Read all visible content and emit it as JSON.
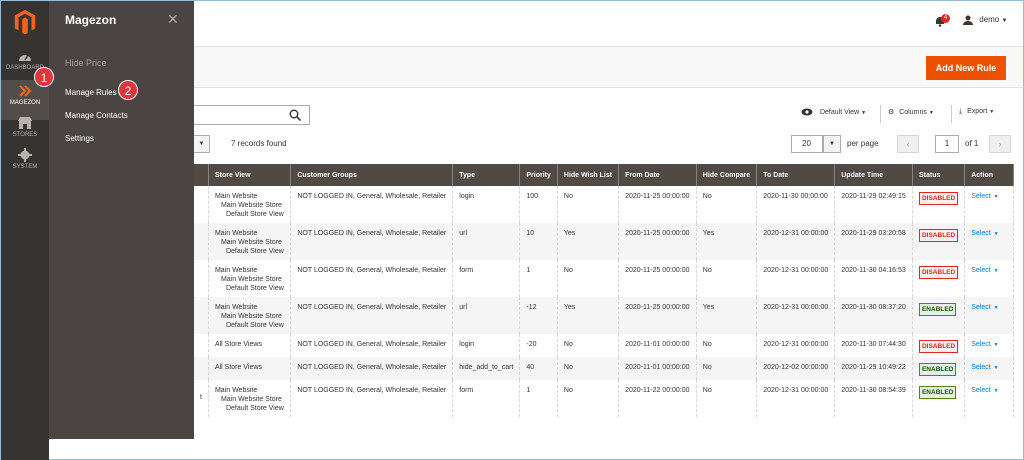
{
  "rail": {
    "items": [
      {
        "label": "DASHBOARD",
        "icon": "dashboard-icon"
      },
      {
        "label": "MAGEZON",
        "icon": "magezon-icon"
      },
      {
        "label": "STORES",
        "icon": "stores-icon"
      },
      {
        "label": "SYSTEM",
        "icon": "gear-icon"
      }
    ],
    "active": "MAGEZON"
  },
  "panel": {
    "title": "Magezon",
    "close": "✕",
    "group": "Hide Price",
    "items": [
      "Manage Rules",
      "Manage Contacts",
      "Settings"
    ]
  },
  "callouts": [
    "1",
    "2"
  ],
  "header": {
    "notifications_count": "4",
    "user": "demo",
    "add_button": "Add New Rule"
  },
  "toolbar": {
    "default_view": "Default View",
    "columns": "Columns",
    "export": "Export",
    "records": "7 records found",
    "per_page_value": "20",
    "per_page_label": "per page",
    "page_value": "1",
    "of_label": "of 1"
  },
  "table": {
    "columns": [
      "",
      "Store View",
      "Customer Groups",
      "Type",
      "Priority",
      "Hide Wish List",
      "From Date",
      "Hide Compare",
      "To Date",
      "Update Time",
      "Status",
      "Action"
    ],
    "rows": [
      {
        "sv": [
          "Main Website",
          "Main Website Store",
          "Default Store View"
        ],
        "groups": "NOT LOGGED IN, General, Wholesale, Retailer",
        "type": "login",
        "priority": "100",
        "wish": "No",
        "from": "2020-11-25 00:00:00",
        "compare": "No",
        "to": "2020-11-30 00:00:00",
        "update": "2020-11-29 02:49:15",
        "status": "DISABLED",
        "action": "Select"
      },
      {
        "sv": [
          "Main Website",
          "Main Website Store",
          "Default Store View"
        ],
        "groups": "NOT LOGGED IN, General, Wholesale, Retailer",
        "type": "url",
        "priority": "10",
        "wish": "Yes",
        "from": "2020-11-25 00:00:00",
        "compare": "Yes",
        "to": "2020-12-31 00:00:00",
        "update": "2020-11-29 03:20:58",
        "status": "DISABLED",
        "action": "Select"
      },
      {
        "sv": [
          "Main Website",
          "Main Website Store",
          "Default Store View"
        ],
        "groups": "NOT LOGGED IN, General, Wholesale, Retailer",
        "type": "form",
        "priority": "1",
        "wish": "No",
        "from": "2020-11-25 00:00:00",
        "compare": "No",
        "to": "2020-12-31 00:00:00",
        "update": "2020-11-30 04:16:53",
        "status": "DISABLED",
        "action": "Select"
      },
      {
        "sv": [
          "Main Website",
          "Main Website Store",
          "Default Store View"
        ],
        "groups": "NOT LOGGED IN, General, Wholesale, Retailer",
        "type": "url",
        "priority": "-12",
        "wish": "Yes",
        "from": "2020-11-25 00:00:00",
        "compare": "Yes",
        "to": "2020-12-31 00:00:00",
        "update": "2020-11-30 08:37:20",
        "status": "ENABLED",
        "action": "Select"
      },
      {
        "sv": [
          "All Store Views"
        ],
        "groups": "NOT LOGGED IN, General, Wholesale, Retailer",
        "type": "login",
        "priority": "-20",
        "wish": "No",
        "from": "2020-11-01 00:00:00",
        "compare": "No",
        "to": "2020-12-31 00:00:00",
        "update": "2020-11-30 07:44:30",
        "status": "DISABLED",
        "action": "Select"
      },
      {
        "sv": [
          "All Store Views"
        ],
        "groups": "NOT LOGGED IN, General, Wholesale, Retailer",
        "type": "hide_add_to_cart",
        "priority": "40",
        "wish": "No",
        "from": "2020-11-01 00:00:00",
        "compare": "No",
        "to": "2020-12-02 00:00:00",
        "update": "2020-11-29 10:49:22",
        "status": "ENABLED",
        "action": "Select"
      },
      {
        "sv": [
          "Main Website",
          "Main Website Store",
          "Default Store View"
        ],
        "lead": "t",
        "groups": "NOT LOGGED IN, General, Wholesale, Retailer",
        "type": "form",
        "priority": "1",
        "wish": "No",
        "from": "2020-11-22 00:00:00",
        "compare": "No",
        "to": "2020-12-31 00:00:00",
        "update": "2020-11-30 08:54:39",
        "status": "ENABLED",
        "action": "Select"
      }
    ]
  },
  "colors": {
    "accent": "#eb5202",
    "sidebar": "#373330",
    "panel": "#4a4542",
    "header_row": "#514943",
    "disabled": "#e22626",
    "enabled": "#185b00",
    "link": "#007bdb"
  }
}
